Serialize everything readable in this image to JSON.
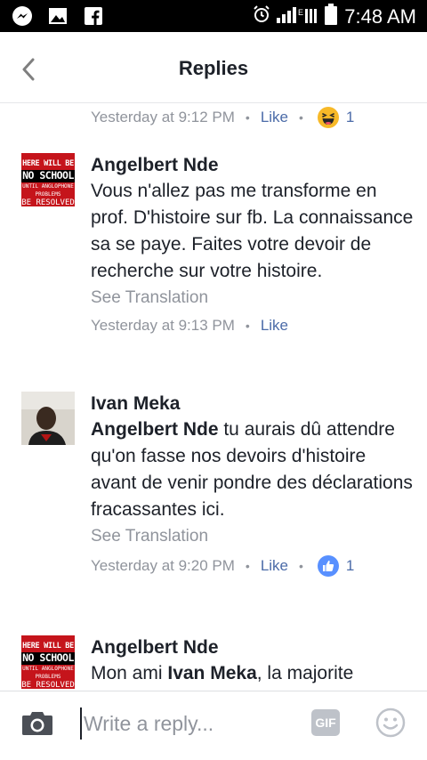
{
  "status_bar": {
    "time": "7:48 AM",
    "icons": [
      "messenger-icon",
      "gallery-icon",
      "facebook-icon"
    ],
    "right_icons": [
      "alarm-icon",
      "signal-icon",
      "battery-icon"
    ]
  },
  "header": {
    "title": "Replies",
    "back_icon": "chevron-left-icon"
  },
  "first_meta": {
    "time": "Yesterday at 9:12 PM",
    "like": "Like",
    "reaction_icon": "haha-icon",
    "reaction_count": "1"
  },
  "comments": [
    {
      "name": "Angelbert Nde",
      "avatar_text": [
        "HERE WILL BE",
        "NO SCHOOL",
        "UNTIL ANGLOPHONE",
        "PROBLEMS",
        "BE RESOLVED"
      ],
      "text": "Vous n'allez pas me transforme en prof. D'histoire sur fb. La connaissance sa se paye. Faites votre devoir de recherche sur votre histoire.",
      "see_translation": "See Translation",
      "time": "Yesterday at 9:13 PM",
      "like": "Like"
    },
    {
      "name": "Ivan Meka",
      "mention": "Angelbert Nde",
      "text": " tu aurais dû attendre qu'on fasse nos devoirs d'histoire avant de venir pondre des déclarations fracassantes ici.",
      "see_translation": "See Translation",
      "time": "Yesterday at 9:20 PM",
      "like": "Like",
      "reaction_icon": "thumbs-up-icon",
      "reaction_count": "1"
    },
    {
      "name": "Angelbert Nde",
      "avatar_text": [
        "HERE WILL BE",
        "NO SCHOOL",
        "UNTIL ANGLOPHONE",
        "PROBLEMS",
        "BE RESOLVED"
      ],
      "text_before": "Mon ami ",
      "mention": "Ivan Meka",
      "text_after": ", la majorite"
    }
  ],
  "reply_bar": {
    "placeholder": "Write a reply...",
    "camera_icon": "camera-icon",
    "gif_label": "GIF",
    "emoji_icon": "smiley-icon"
  },
  "colors": {
    "link": "#4b6ba8",
    "meta": "#90949c",
    "like_reaction": "#5890ff",
    "haha_reaction": "#f7b928"
  }
}
